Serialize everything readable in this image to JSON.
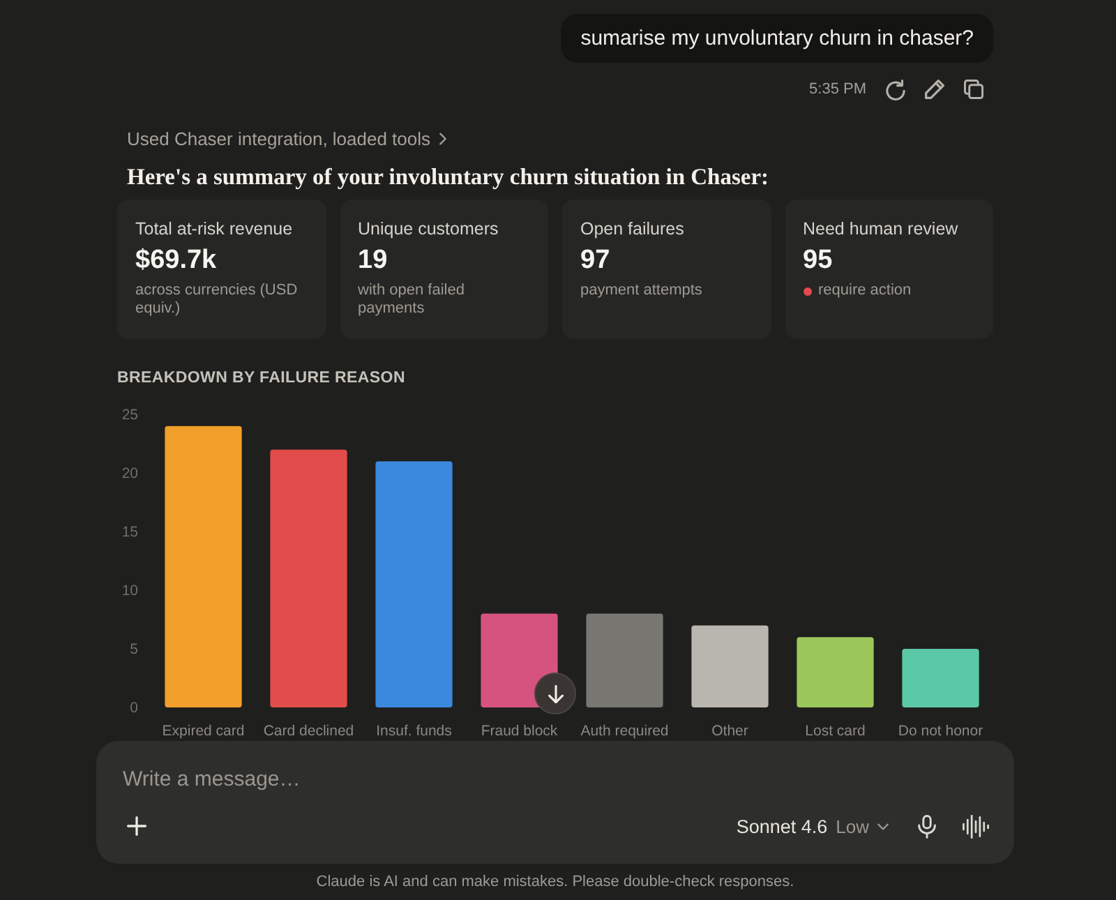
{
  "user_message": {
    "text": "sumarise my unvoluntary churn in chaser?",
    "time": "5:35 PM"
  },
  "response": {
    "tool_note": "Used Chaser integration, loaded tools",
    "heading": "Here's a summary of your involuntary churn situation in Chaser:",
    "cards": [
      {
        "label": "Total at-risk revenue",
        "value": "$69.7k",
        "note": "across currencies (USD equiv.)",
        "flagged": false
      },
      {
        "label": "Unique customers",
        "value": "19",
        "note": "with open failed payments",
        "flagged": false
      },
      {
        "label": "Open failures",
        "value": "97",
        "note": "payment attempts",
        "flagged": false
      },
      {
        "label": "Need human review",
        "value": "95",
        "note": "require action",
        "flagged": true
      }
    ],
    "chart": {
      "chart_data": {
        "type": "bar",
        "title": "BREAKDOWN BY FAILURE REASON",
        "categories": [
          "Expired card",
          "Card declined",
          "Insuf. funds",
          "Fraud block",
          "Auth required",
          "Other",
          "Lost card",
          "Do not honor"
        ],
        "values": [
          24,
          22,
          21,
          8,
          8,
          7,
          6,
          5
        ],
        "colors": [
          "#f2a02b",
          "#e24c4b",
          "#3a89dd",
          "#d6537f",
          "#787771",
          "#b8b6ae",
          "#9cc75b",
          "#5bc9a6"
        ],
        "ylim": [
          0,
          25
        ],
        "yticks": [
          0,
          5,
          10,
          15,
          20,
          25
        ]
      }
    }
  },
  "composer": {
    "placeholder": "Write a message…",
    "model": "Sonnet 4.6",
    "effort": "Low"
  },
  "disclaimer": "Claude is AI and can make mistakes. Please double-check responses."
}
